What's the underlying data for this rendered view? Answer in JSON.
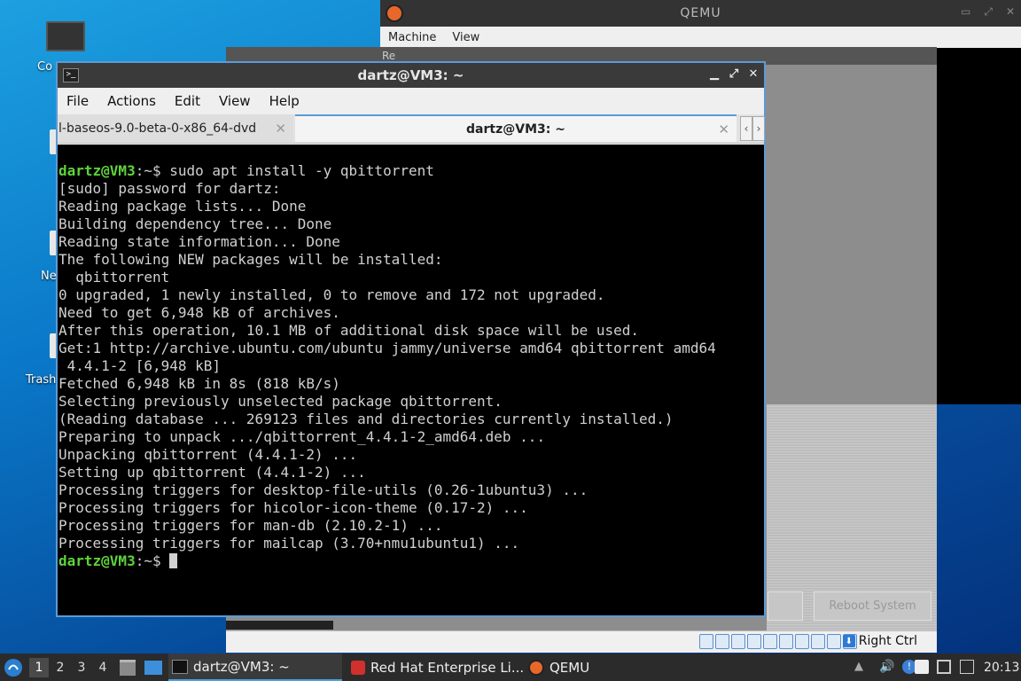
{
  "desktop": {
    "icons": [
      {
        "label": "Co"
      },
      {
        "label": "Ne"
      },
      {
        "label": "Trash"
      }
    ]
  },
  "qemu": {
    "title": "QEMU",
    "menu": [
      "Machine",
      "View"
    ]
  },
  "redhat_vm": {
    "title_fragment": "Re",
    "buttons": [
      "Reboot System"
    ],
    "status_right": "Right Ctrl"
  },
  "terminal": {
    "title": "dartz@VM3: ~",
    "menu": [
      "File",
      "Actions",
      "Edit",
      "View",
      "Help"
    ],
    "tabs": [
      {
        "label": "l-baseos-9.0-beta-0-x86_64-dvd"
      },
      {
        "label": "dartz@VM3: ~"
      }
    ],
    "prompt_user": "dartz@VM3",
    "prompt_path": ":~$",
    "command": " sudo apt install -y qbittorrent",
    "output": [
      "[sudo] password for dartz:",
      "Reading package lists... Done",
      "Building dependency tree... Done",
      "Reading state information... Done",
      "The following NEW packages will be installed:",
      "  qbittorrent",
      "0 upgraded, 1 newly installed, 0 to remove and 172 not upgraded.",
      "Need to get 6,948 kB of archives.",
      "After this operation, 10.1 MB of additional disk space will be used.",
      "Get:1 http://archive.ubuntu.com/ubuntu jammy/universe amd64 qbittorrent amd64",
      " 4.4.1-2 [6,948 kB]",
      "Fetched 6,948 kB in 8s (818 kB/s)",
      "Selecting previously unselected package qbittorrent.",
      "(Reading database ... 269123 files and directories currently installed.)",
      "Preparing to unpack .../qbittorrent_4.4.1-2_amd64.deb ...",
      "Unpacking qbittorrent (4.4.1-2) ...",
      "Setting up qbittorrent (4.4.1-2) ...",
      "Processing triggers for desktop-file-utils (0.26-1ubuntu3) ...",
      "Processing triggers for hicolor-icon-theme (0.17-2) ...",
      "Processing triggers for man-db (2.10.2-1) ...",
      "Processing triggers for mailcap (3.70+nmu1ubuntu1) ..."
    ]
  },
  "taskbar": {
    "workspaces": [
      "1",
      "2",
      "3",
      "4"
    ],
    "tasks": [
      {
        "label": "dartz@VM3: ~"
      },
      {
        "label": "Red Hat Enterprise Li..."
      },
      {
        "label": "QEMU"
      }
    ],
    "clock": "20:13"
  },
  "colors": {
    "prompt_green": "#5fd33a",
    "accent_blue": "#5b9bd5",
    "qemu_orange": "#e8672a"
  }
}
